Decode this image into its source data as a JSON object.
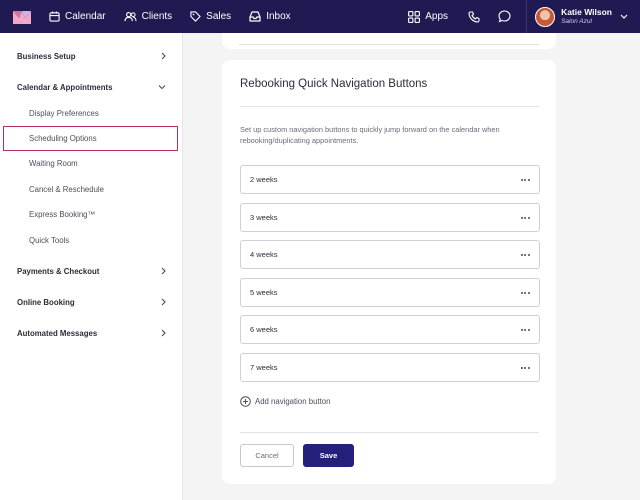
{
  "topnav": {
    "calendar": "Calendar",
    "clients": "Clients",
    "sales": "Sales",
    "inbox": "Inbox",
    "apps": "Apps",
    "user_name": "Katie Wilson",
    "user_business": "Salon Azul"
  },
  "sidebar": {
    "items": [
      {
        "label": "Business Setup"
      },
      {
        "label": "Calendar & Appointments"
      },
      {
        "label": "Display Preferences"
      },
      {
        "label": "Scheduling Options"
      },
      {
        "label": "Waiting Room"
      },
      {
        "label": "Cancel & Reschedule"
      },
      {
        "label": "Express Booking™"
      },
      {
        "label": "Quick Tools"
      },
      {
        "label": "Payments & Checkout"
      },
      {
        "label": "Online Booking"
      },
      {
        "label": "Automated Messages"
      }
    ]
  },
  "main": {
    "title": "Rebooking Quick Navigation Buttons",
    "description": "Set up custom navigation buttons to quickly jump forward on the calendar when rebooking/duplicating appointments.",
    "rows": [
      {
        "label": "2 weeks"
      },
      {
        "label": "3 weeks"
      },
      {
        "label": "4 weeks"
      },
      {
        "label": "5 weeks"
      },
      {
        "label": "6 weeks"
      },
      {
        "label": "7 weeks"
      }
    ],
    "add_label": "Add navigation button",
    "cancel_label": "Cancel",
    "save_label": "Save"
  },
  "colors": {
    "topbar": "#1f1a52",
    "primary": "#25207a",
    "active_outline": "#b0306a"
  },
  "icons": [
    "logo-icon",
    "calendar-icon",
    "clients-icon",
    "sales-tag-icon",
    "inbox-icon",
    "apps-grid-icon",
    "phone-icon",
    "chat-icon",
    "chevron-down-icon",
    "chevron-right-icon",
    "more-dots-icon",
    "plus-circle-icon"
  ]
}
